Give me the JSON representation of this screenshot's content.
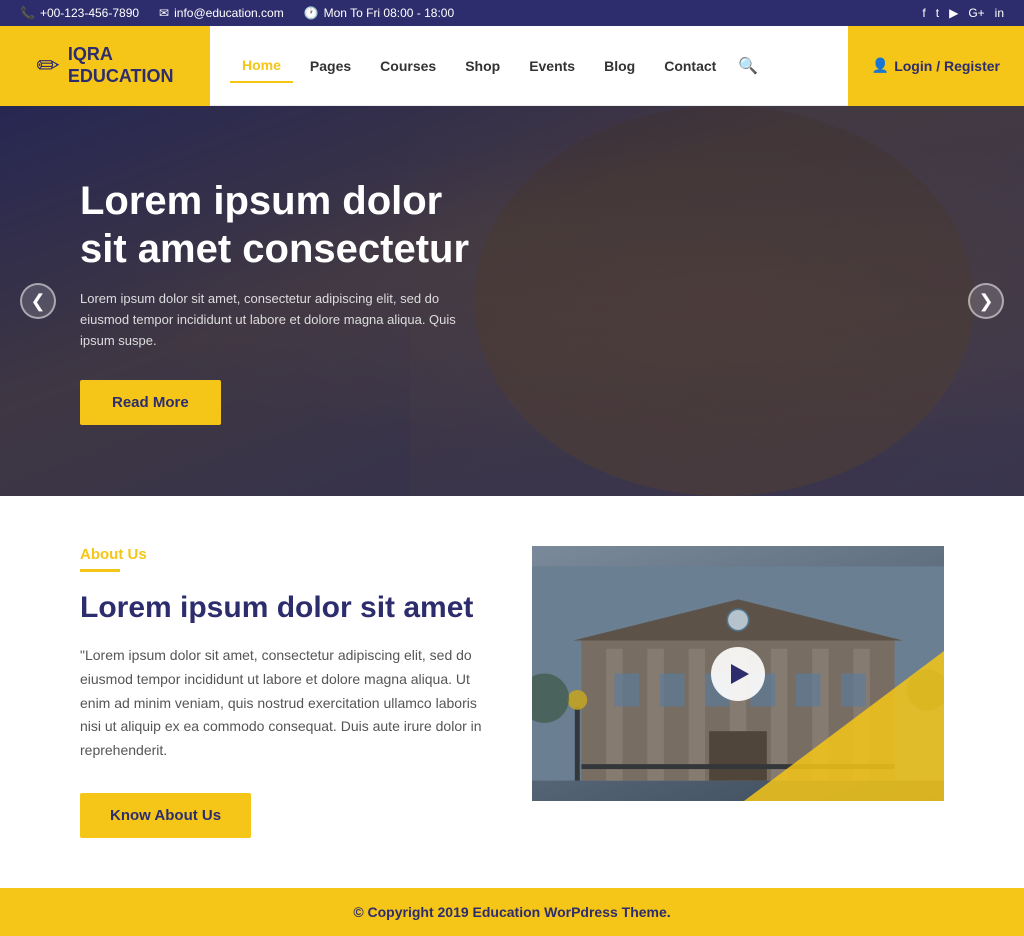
{
  "topbar": {
    "phone": "+00-123-456-7890",
    "email": "info@education.com",
    "hours": "Mon To Fri 08:00 - 18:00",
    "phone_icon": "📞",
    "email_icon": "✉",
    "clock_icon": "🕐",
    "socials": [
      "f",
      "t",
      "▶",
      "G+",
      "in"
    ]
  },
  "header": {
    "logo_icon": "✏",
    "logo_line1": "IQRA",
    "logo_line2": "EDUCATION",
    "nav_items": [
      {
        "label": "Home",
        "active": true
      },
      {
        "label": "Pages",
        "active": false
      },
      {
        "label": "Courses",
        "active": false
      },
      {
        "label": "Shop",
        "active": false
      },
      {
        "label": "Events",
        "active": false
      },
      {
        "label": "Blog",
        "active": false
      },
      {
        "label": "Contact",
        "active": false
      }
    ],
    "login_label": "Login / Register",
    "login_icon": "👤"
  },
  "hero": {
    "title": "Lorem ipsum dolor sit amet consectetur",
    "description": "Lorem ipsum dolor sit amet, consectetur adipiscing elit, sed do eiusmod tempor incididunt ut labore et dolore magna aliqua. Quis ipsum suspe.",
    "btn_label": "Read More",
    "arrow_left": "❮",
    "arrow_right": "❯"
  },
  "about": {
    "section_label": "About Us",
    "title": "Lorem ipsum dolor sit amet",
    "description": "\"Lorem ipsum dolor sit amet, consectetur adipiscing elit, sed do eiusmod tempor incididunt ut labore et dolore magna aliqua. Ut enim ad minim veniam, quis nostrud exercitation ullamco laboris nisi ut aliquip ex ea commodo consequat. Duis aute irure dolor in reprehenderit.",
    "btn_label": "Know About Us",
    "play_label": "▶"
  },
  "footer": {
    "text": "© Copyright 2019 Education WorPdress Theme."
  }
}
